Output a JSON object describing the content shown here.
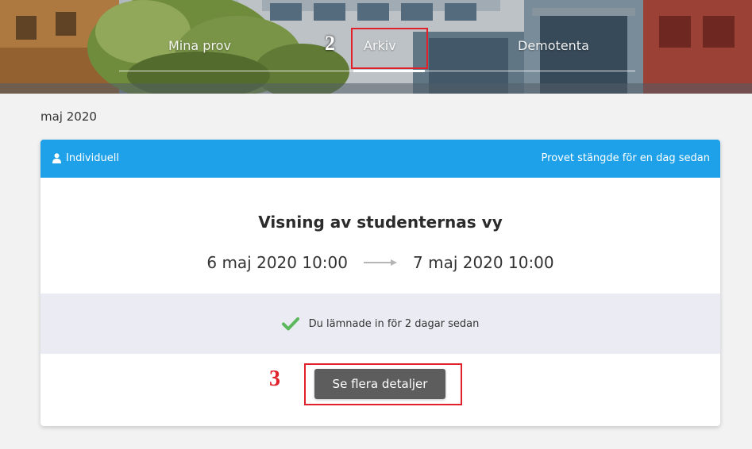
{
  "nav": {
    "items": [
      {
        "label": "Mina prov"
      },
      {
        "label": "Arkiv"
      },
      {
        "label": "Demotenta"
      }
    ],
    "active": "Arkiv"
  },
  "annotations": {
    "step2": "2",
    "step3": "3",
    "color": "#e0202b"
  },
  "archive": {
    "month": "maj 2020"
  },
  "card": {
    "type_label": "Individuell",
    "type_icon": "user-icon",
    "closed_text": "Provet stängde för en dag sedan",
    "title": "Visning av studenternas vy",
    "start": "6 maj 2020 10:00",
    "end": "7 maj 2020 10:00",
    "status_text": "Du lämnade in för 2 dagar sedan",
    "status_icon": "checkmark-icon",
    "details_button": "Se flera detaljer"
  },
  "colors": {
    "header_blue": "#1ea1e8",
    "status_green": "#5cb85c",
    "button_gray": "#5d5d5d",
    "status_band": "#ebecf3",
    "annotation_red": "#e0202b"
  }
}
